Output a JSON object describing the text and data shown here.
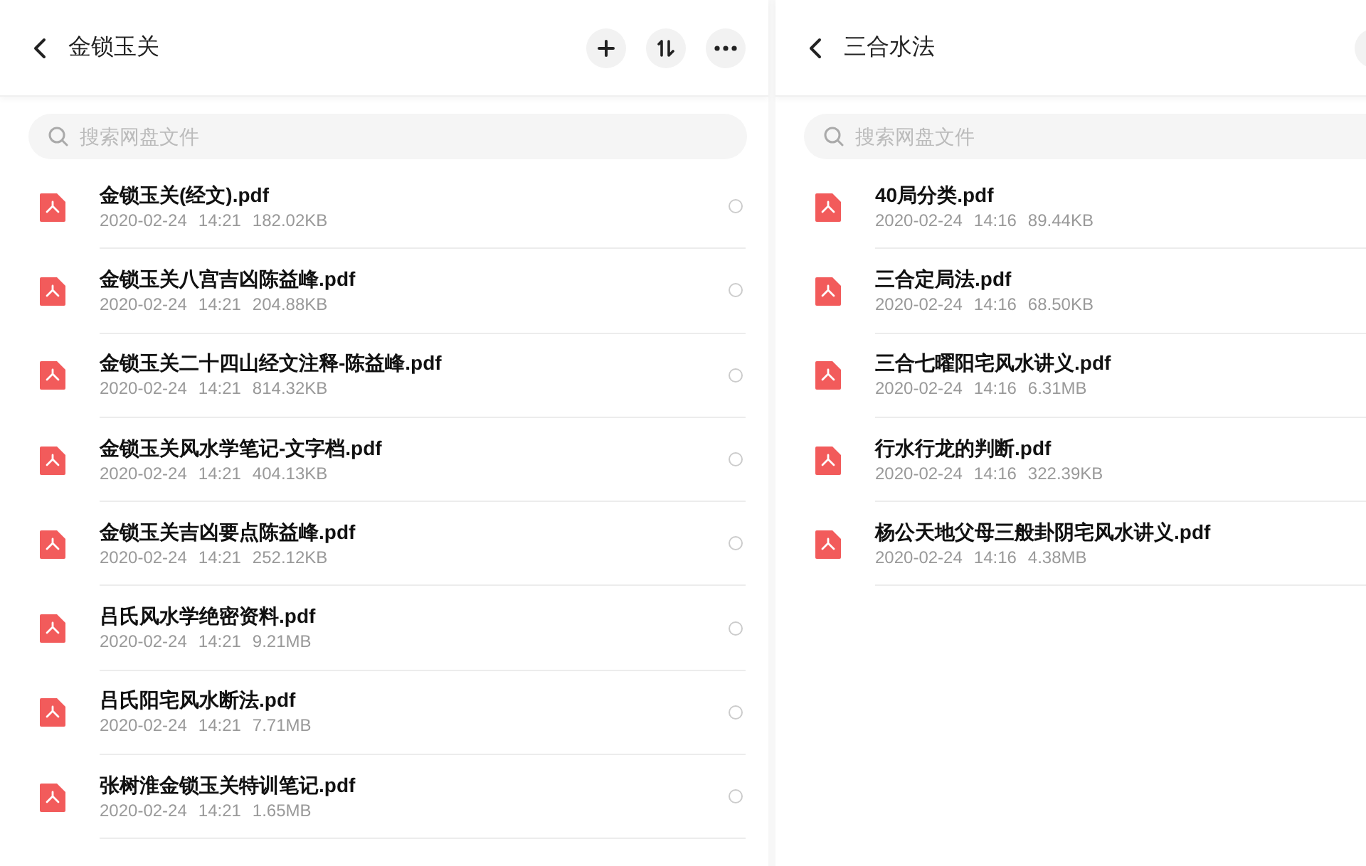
{
  "panels": [
    {
      "title": "金锁玉关",
      "actions": [
        {
          "kind": "add"
        },
        {
          "kind": "sort"
        },
        {
          "kind": "more"
        }
      ],
      "search": {
        "placeholder": "搜索网盘文件"
      },
      "files": [
        {
          "name": "金锁玉关(经文).pdf",
          "date": "2020-02-24",
          "time": "14:21",
          "size": "182.02KB",
          "selected": false
        },
        {
          "name": "金锁玉关八宫吉凶陈益峰.pdf",
          "date": "2020-02-24",
          "time": "14:21",
          "size": "204.88KB",
          "selected": false
        },
        {
          "name": "金锁玉关二十四山经文注释-陈益峰.pdf",
          "date": "2020-02-24",
          "time": "14:21",
          "size": "814.32KB",
          "selected": false
        },
        {
          "name": "金锁玉关风水学笔记-文字档.pdf",
          "date": "2020-02-24",
          "time": "14:21",
          "size": "404.13KB",
          "selected": false
        },
        {
          "name": "金锁玉关吉凶要点陈益峰.pdf",
          "date": "2020-02-24",
          "time": "14:21",
          "size": "252.12KB",
          "selected": false
        },
        {
          "name": "吕氏风水学绝密资料.pdf",
          "date": "2020-02-24",
          "time": "14:21",
          "size": "9.21MB",
          "selected": false
        },
        {
          "name": "吕氏阳宅风水断法.pdf",
          "date": "2020-02-24",
          "time": "14:21",
          "size": "7.71MB",
          "selected": false
        },
        {
          "name": "张树淮金锁玉关特训笔记.pdf",
          "date": "2020-02-24",
          "time": "14:21",
          "size": "1.65MB",
          "selected": false
        }
      ]
    },
    {
      "title": "三合水法",
      "actions": [
        {
          "kind": "partial"
        }
      ],
      "search": {
        "placeholder": "搜索网盘文件"
      },
      "files": [
        {
          "name": "40局分类.pdf",
          "date": "2020-02-24",
          "time": "14:16",
          "size": "89.44KB"
        },
        {
          "name": "三合定局法.pdf",
          "date": "2020-02-24",
          "time": "14:16",
          "size": "68.50KB"
        },
        {
          "name": "三合七曜阳宅风水讲义.pdf",
          "date": "2020-02-24",
          "time": "14:16",
          "size": "6.31MB"
        },
        {
          "name": "行水行龙的判断.pdf",
          "date": "2020-02-24",
          "time": "14:16",
          "size": "322.39KB"
        },
        {
          "name": "杨公天地父母三般卦阴宅风水讲义.pdf",
          "date": "2020-02-24",
          "time": "14:16",
          "size": "4.38MB"
        }
      ]
    }
  ]
}
